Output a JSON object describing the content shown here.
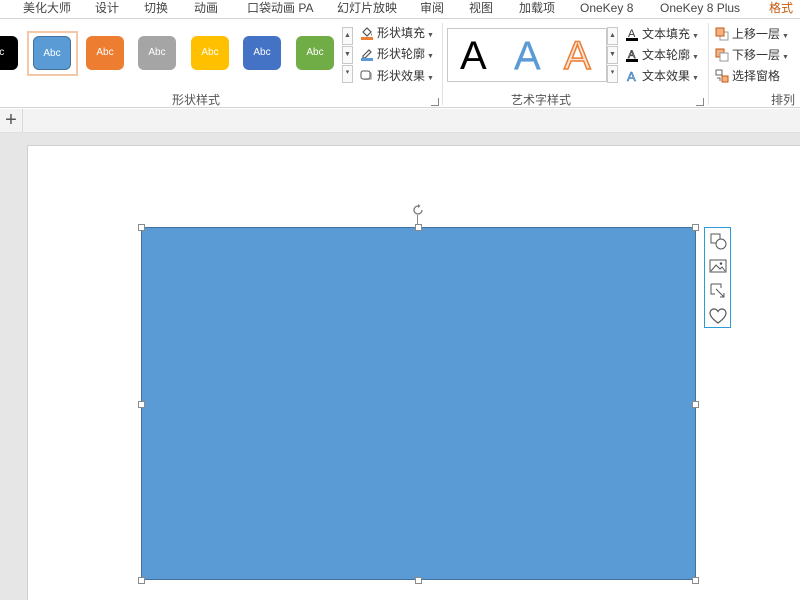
{
  "tabs": [
    {
      "label": "美化大师",
      "active": false
    },
    {
      "label": "设计",
      "active": false
    },
    {
      "label": "切换",
      "active": false
    },
    {
      "label": "动画",
      "active": false
    },
    {
      "label": "口袋动画 PA",
      "active": false
    },
    {
      "label": "幻灯片放映",
      "active": false
    },
    {
      "label": "审阅",
      "active": false
    },
    {
      "label": "视图",
      "active": false
    },
    {
      "label": "加载项",
      "active": false
    },
    {
      "label": "OneKey 8",
      "active": false
    },
    {
      "label": "OneKey 8 Plus",
      "active": false
    },
    {
      "label": "格式",
      "active": true
    }
  ],
  "shape_styles": {
    "group_label": "形状样式",
    "presets": [
      {
        "label": "bc",
        "color": "#000000"
      },
      {
        "label": "Abc",
        "color": "#5b9bd5",
        "selected": true
      },
      {
        "label": "Abc",
        "color": "#ed7d31"
      },
      {
        "label": "Abc",
        "color": "#a5a5a5"
      },
      {
        "label": "Abc",
        "color": "#ffc000"
      },
      {
        "label": "Abc",
        "color": "#4472c4"
      },
      {
        "label": "Abc",
        "color": "#70ad47"
      }
    ],
    "fill_label": "形状填充",
    "outline_label": "形状轮廓",
    "effects_label": "形状效果"
  },
  "wordart": {
    "group_label": "艺术字样式",
    "samples": [
      {
        "label": "A",
        "style": "plain-black"
      },
      {
        "label": "A",
        "style": "blue-gradient"
      },
      {
        "label": "A",
        "style": "orange-outline"
      }
    ],
    "text_fill_label": "文本填充",
    "text_outline_label": "文本轮廓",
    "text_effects_label": "文本效果"
  },
  "arrange": {
    "group_label": "排列",
    "bring_forward_label": "上移一层",
    "send_backward_label": "下移一层",
    "selection_pane_label": "选择窗格"
  },
  "quickbar": {
    "add_label": "+"
  },
  "canvas": {
    "shape_color": "#5b9bd5",
    "shape_border": "#41719c",
    "side_tools": [
      "layout-options-icon",
      "picture-icon",
      "resize-icon",
      "heart-icon"
    ]
  },
  "colors": {
    "accent": "#c55a11",
    "selection": "#2e9bd6"
  }
}
